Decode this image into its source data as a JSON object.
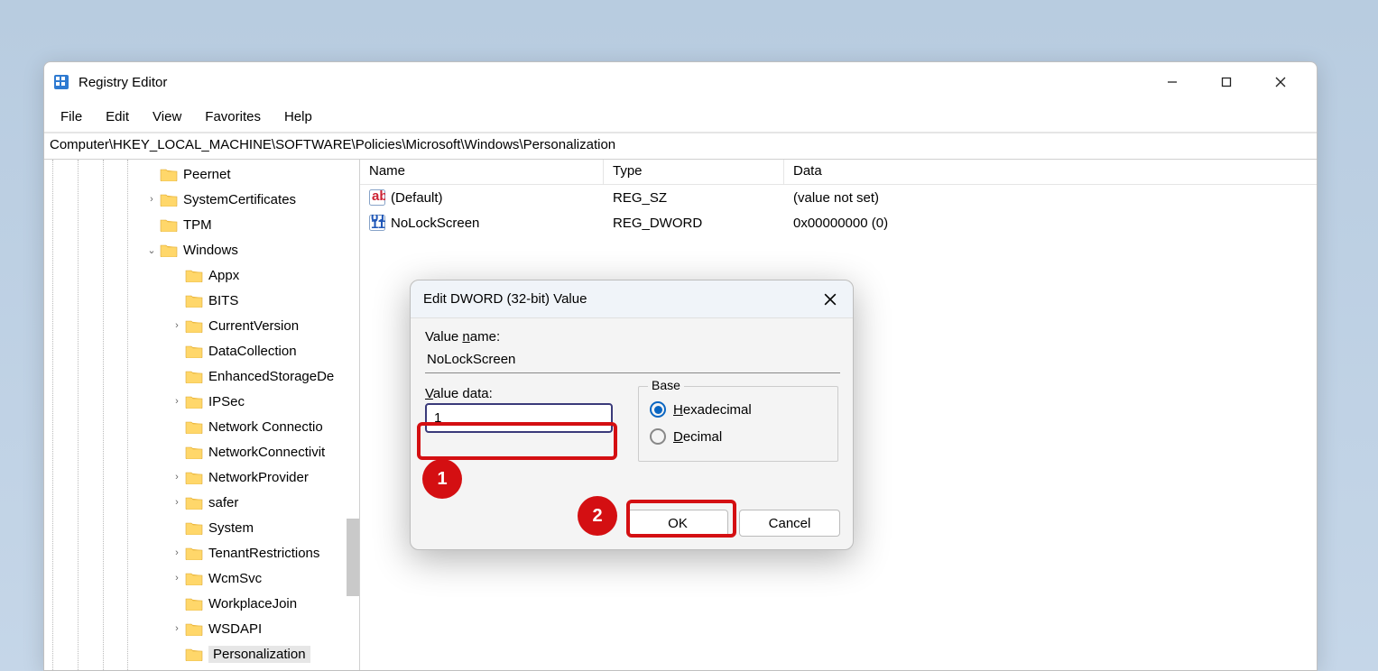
{
  "window": {
    "title": "Registry Editor",
    "menu": [
      "File",
      "Edit",
      "View",
      "Favorites",
      "Help"
    ],
    "address": "Computer\\HKEY_LOCAL_MACHINE\\SOFTWARE\\Policies\\Microsoft\\Windows\\Personalization"
  },
  "tree": {
    "items": [
      {
        "label": "Peernet",
        "indent": 1,
        "chev": ""
      },
      {
        "label": "SystemCertificates",
        "indent": 1,
        "chev": "›"
      },
      {
        "label": "TPM",
        "indent": 1,
        "chev": ""
      },
      {
        "label": "Windows",
        "indent": 1,
        "chev": "⌄",
        "expanded": true
      },
      {
        "label": "Appx",
        "indent": 2,
        "chev": ""
      },
      {
        "label": "BITS",
        "indent": 2,
        "chev": ""
      },
      {
        "label": "CurrentVersion",
        "indent": 2,
        "chev": "›"
      },
      {
        "label": "DataCollection",
        "indent": 2,
        "chev": ""
      },
      {
        "label": "EnhancedStorageDe",
        "indent": 2,
        "chev": ""
      },
      {
        "label": "IPSec",
        "indent": 2,
        "chev": "›"
      },
      {
        "label": "Network Connectio",
        "indent": 2,
        "chev": ""
      },
      {
        "label": "NetworkConnectivit",
        "indent": 2,
        "chev": ""
      },
      {
        "label": "NetworkProvider",
        "indent": 2,
        "chev": "›"
      },
      {
        "label": "safer",
        "indent": 2,
        "chev": "›"
      },
      {
        "label": "System",
        "indent": 2,
        "chev": ""
      },
      {
        "label": "TenantRestrictions",
        "indent": 2,
        "chev": "›"
      },
      {
        "label": "WcmSvc",
        "indent": 2,
        "chev": "›"
      },
      {
        "label": "WorkplaceJoin",
        "indent": 2,
        "chev": ""
      },
      {
        "label": "WSDAPI",
        "indent": 2,
        "chev": "›"
      },
      {
        "label": "Personalization",
        "indent": 2,
        "chev": "",
        "selected": true
      }
    ]
  },
  "list": {
    "cols": {
      "name": "Name",
      "type": "Type",
      "data": "Data"
    },
    "rows": [
      {
        "icon": "ab",
        "name": "(Default)",
        "type": "REG_SZ",
        "data": "(value not set)"
      },
      {
        "icon": "011",
        "name": "NoLockScreen",
        "type": "REG_DWORD",
        "data": "0x00000000 (0)"
      }
    ]
  },
  "dialog": {
    "title": "Edit DWORD (32-bit) Value",
    "value_name_label": "Value name:",
    "value_name_n": "n",
    "value_name": "NoLockScreen",
    "value_data_label": "Value data:",
    "value_data_v": "V",
    "value_data": "1",
    "base_label": "Base",
    "hex_h": "H",
    "hex_rest": "exadecimal",
    "dec_d": "D",
    "dec_rest": "ecimal",
    "ok": "OK",
    "cancel": "Cancel"
  },
  "annotations": {
    "one": "1",
    "two": "2"
  }
}
